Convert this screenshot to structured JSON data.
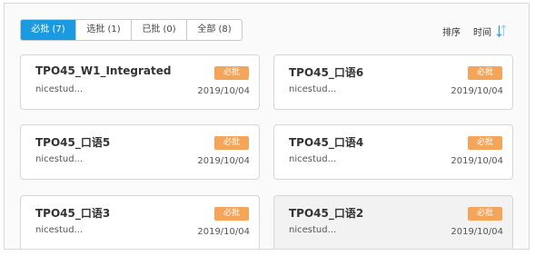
{
  "tabs": [
    {
      "label": "必批 (7)",
      "active": true
    },
    {
      "label": "选批 (1)",
      "active": false
    },
    {
      "label": "已批 (0)",
      "active": false
    },
    {
      "label": "全部 (8)",
      "active": false
    }
  ],
  "sort": {
    "label": "排序",
    "time_label": "时间",
    "icon": "sort-arrows-icon"
  },
  "cards": [
    {
      "title": "TPO45_W1_Integrated",
      "badge": "必批",
      "author": "nicestud...",
      "date": "2019/10/04"
    },
    {
      "title": "TPO45_口语6",
      "badge": "必批",
      "author": "nicestud...",
      "date": "2019/10/04"
    },
    {
      "title": "TPO45_口语5",
      "badge": "必批",
      "author": "nicestud...",
      "date": "2019/10/04"
    },
    {
      "title": "TPO45_口语4",
      "badge": "必批",
      "author": "nicestud...",
      "date": "2019/10/04"
    },
    {
      "title": "TPO45_口语3",
      "badge": "必批",
      "author": "nicestud...",
      "date": "2019/10/04"
    },
    {
      "title": "TPO45_口语2",
      "badge": "必批",
      "author": "nicestud...",
      "date": "2019/10/04"
    }
  ],
  "colors": {
    "accent": "#1a9ae0",
    "badge": "#f5a55a"
  }
}
